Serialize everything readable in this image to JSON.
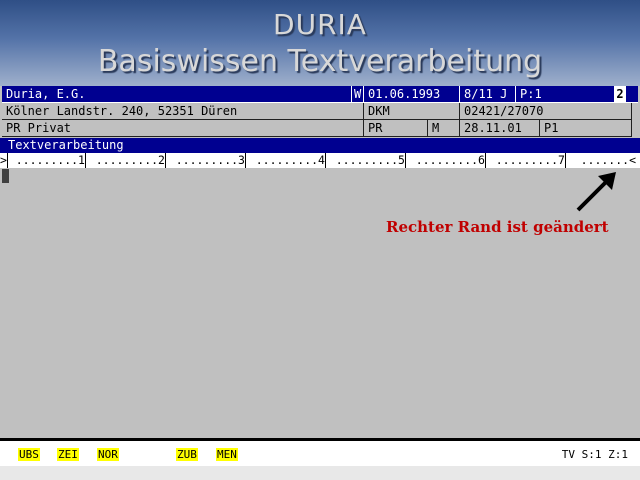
{
  "title": {
    "line1": "DURIA",
    "line2": "Basiswissen Textverarbeitung"
  },
  "records": {
    "row0": [
      "Duria, E.G.",
      "W",
      "01.06.1993",
      "8/11 J",
      "P:1"
    ],
    "row0_badge": "2",
    "row1": [
      "Kölner Landstr. 240, 52351 Düren",
      "DKM",
      "02421/27070"
    ],
    "row2": [
      "PR Privat",
      "PR",
      "M",
      "28.11.01",
      "P1"
    ]
  },
  "section_label": "Textverarbeitung",
  "ruler": {
    "start": ">",
    "segments": [
      ".........1",
      ".........2",
      ".........3",
      ".........4",
      ".........5",
      ".........6",
      ".........7",
      ".......<"
    ]
  },
  "annotation": "Rechter Rand ist geändert",
  "function_keys": [
    "UBS",
    "ZEI",
    "NOR",
    "ZUB",
    "MEN"
  ],
  "status": "TV S:1 Z:1",
  "colors": {
    "bar_blue": "#000090",
    "note_red": "#c00000",
    "key_yellow": "#ffff00"
  }
}
